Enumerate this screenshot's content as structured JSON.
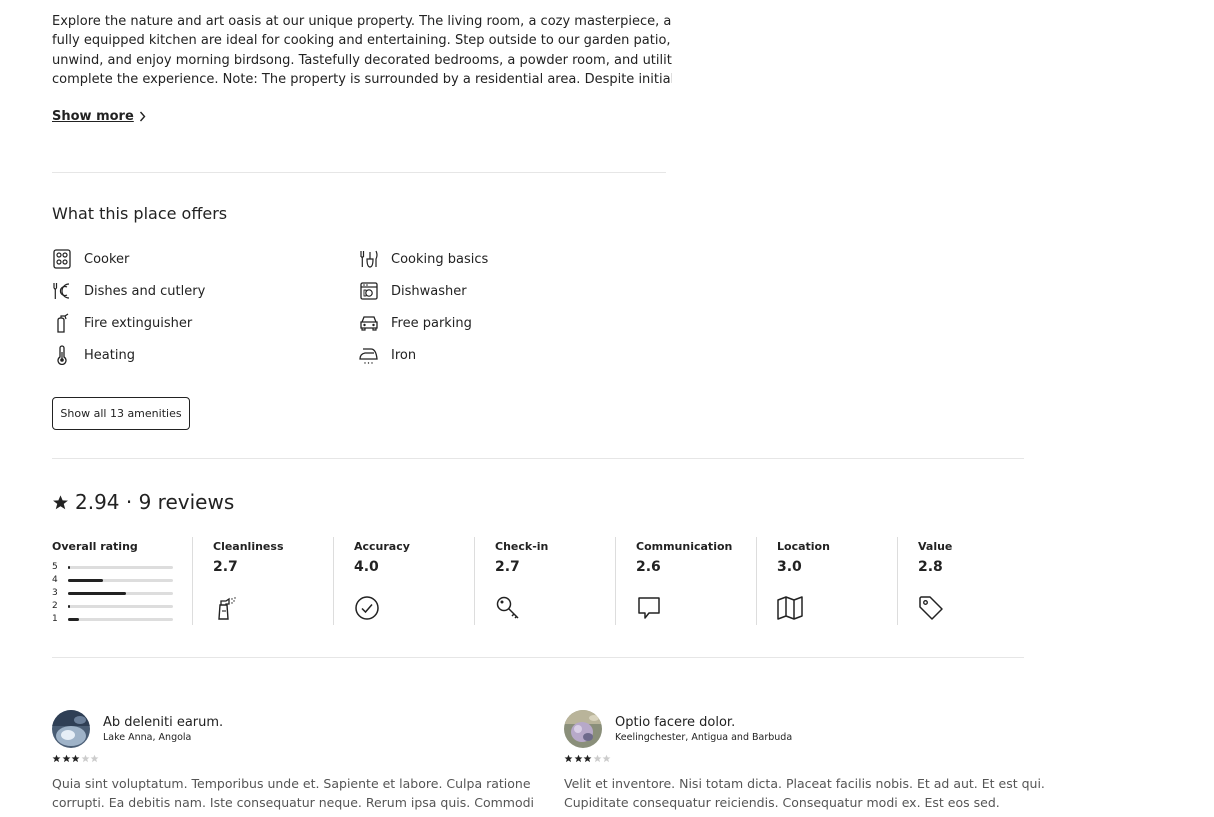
{
  "description": {
    "lines": [
      "Explore the nature and art oasis at our unique property. The living room, a cozy masterpiece, and the",
      "fully equipped kitchen are ideal for cooking and entertaining. Step outside to our garden patio,",
      "unwind, and enjoy morning birdsong. Tastefully decorated bedrooms, a powder room, and utility area",
      "complete the experience. Note: The property is surrounded by a residential area. Despite initial su..."
    ],
    "show_more_label": "Show more"
  },
  "amenities": {
    "title": "What this place offers",
    "items": [
      {
        "label": "Cooker",
        "icon": "cooker-icon"
      },
      {
        "label": "Cooking basics",
        "icon": "cooking-basics-icon"
      },
      {
        "label": "Dishes and cutlery",
        "icon": "dishes-cutlery-icon"
      },
      {
        "label": "Dishwasher",
        "icon": "dishwasher-icon"
      },
      {
        "label": "Fire extinguisher",
        "icon": "fire-extinguisher-icon"
      },
      {
        "label": "Free parking",
        "icon": "car-icon"
      },
      {
        "label": "Heating",
        "icon": "thermometer-icon"
      },
      {
        "label": "Iron",
        "icon": "iron-icon"
      }
    ],
    "show_all_label": "Show all 13 amenities"
  },
  "reviews": {
    "heading": "2.94 · 9 reviews",
    "overall": {
      "label": "Overall rating",
      "rows": [
        {
          "star": "5",
          "fraction": 0.02
        },
        {
          "star": "4",
          "fraction": 0.33
        },
        {
          "star": "3",
          "fraction": 0.55
        },
        {
          "star": "2",
          "fraction": 0.02
        },
        {
          "star": "1",
          "fraction": 0.1
        }
      ]
    },
    "categories": [
      {
        "name": "Cleanliness",
        "value": "2.7",
        "icon": "spray-bottle-icon"
      },
      {
        "name": "Accuracy",
        "value": "4.0",
        "icon": "check-circle-icon"
      },
      {
        "name": "Check-in",
        "value": "2.7",
        "icon": "key-icon"
      },
      {
        "name": "Communication",
        "value": "2.6",
        "icon": "chat-bubble-icon"
      },
      {
        "name": "Location",
        "value": "3.0",
        "icon": "map-icon"
      },
      {
        "name": "Value",
        "value": "2.8",
        "icon": "price-tag-icon"
      }
    ],
    "items": [
      {
        "name": "Ab deleniti earum.",
        "location": "Lake Anna, Angola",
        "stars": 3,
        "text_lines": [
          "Quia sint voluptatum. Temporibus unde et. Sapiente et labore. Culpa ratione",
          "corrupti. Ea debitis nam. Iste consequatur neque. Rerum ipsa quis. Commodi"
        ]
      },
      {
        "name": "Optio facere dolor.",
        "location": "Keelingchester, Antigua and Barbuda",
        "stars": 3,
        "text_lines": [
          "Velit et inventore. Nisi totam dicta. Placeat facilis nobis. Et ad aut. Et est qui.",
          "Cupiditate consequatur reiciendis. Consequatur modi ex. Est eos sed."
        ]
      }
    ]
  },
  "colors": {
    "text": "#222222",
    "muted_text": "#555555",
    "divider": "#e6e6e6",
    "bar_track": "#dddddd",
    "star_inactive": "#cccccc"
  }
}
